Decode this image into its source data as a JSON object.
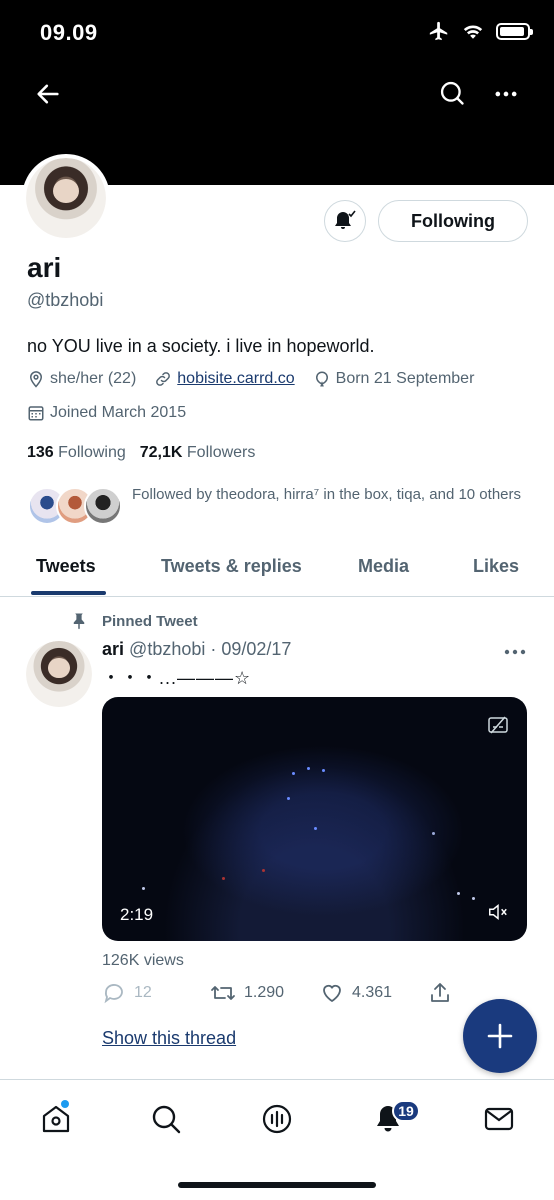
{
  "status_bar": {
    "time": "09.09",
    "icons": [
      "airplane-icon",
      "wifi-icon",
      "battery-icon"
    ]
  },
  "header": {
    "icons": [
      "back-arrow-icon",
      "search-icon",
      "more-icon"
    ]
  },
  "profile": {
    "name": "ari",
    "handle": "@tbzhobi",
    "bio": "no YOU live in a society. i live in hopeworld.",
    "pronouns": "she/her (22)",
    "website": "hobisite.carrd.co",
    "birthday": "Born 21 September",
    "joined": "Joined March 2015",
    "following_count": "136",
    "following_label": "Following",
    "followers_count": "72,1K",
    "followers_label": "Followers",
    "followed_by": "Followed by theodora, hirra⁷ in the box, tiqa, and 10 others",
    "follow_button": "Following"
  },
  "tabs": [
    {
      "label": "Tweets",
      "active": true
    },
    {
      "label": "Tweets & replies",
      "active": false
    },
    {
      "label": "Media",
      "active": false
    },
    {
      "label": "Likes",
      "active": false
    }
  ],
  "pinned_tweet": {
    "pinned_label": "Pinned Tweet",
    "name": "ari",
    "handle_date": "@tbzhobi · 09/02/17",
    "text": "・・・...———☆",
    "video_duration": "2:19",
    "views": "126K views",
    "replies": "12",
    "retweets": "1.290",
    "likes": "4.361",
    "show_thread": "Show this thread"
  },
  "bottom_nav": {
    "items": [
      "home-icon",
      "search-icon",
      "spaces-icon",
      "notifications-icon",
      "messages-icon"
    ],
    "notification_badge": "19"
  },
  "colors": {
    "accent": "#1a3a7e",
    "text": "#0f1419",
    "muted": "#536471",
    "border": "#cfd9de"
  }
}
